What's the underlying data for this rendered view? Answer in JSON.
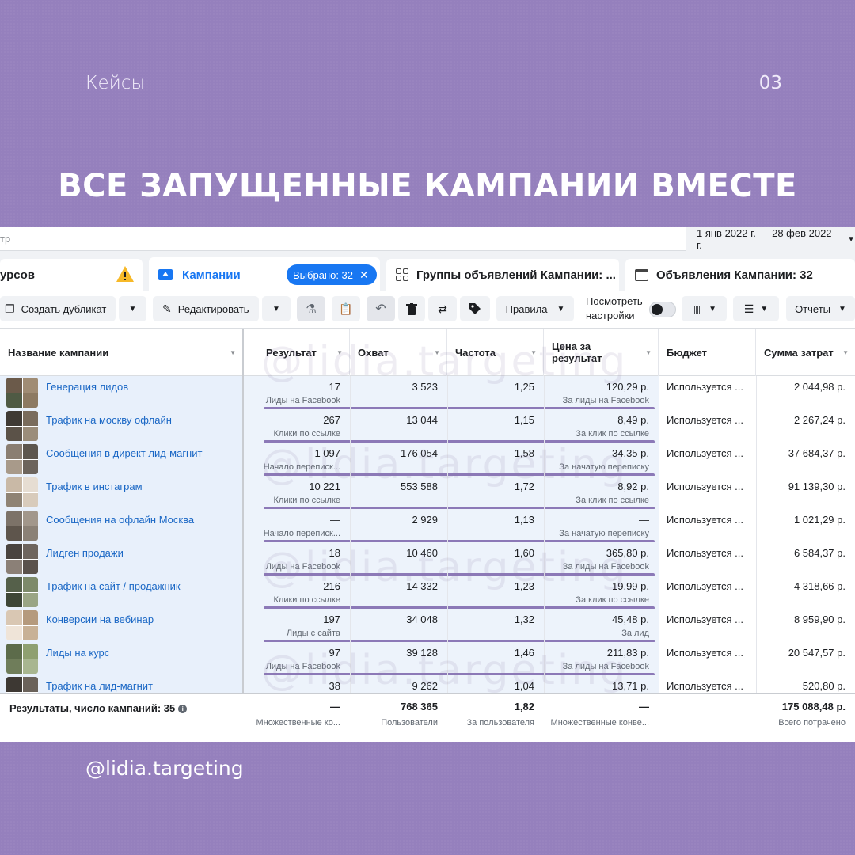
{
  "slide": {
    "section": "Кейсы",
    "page_number": "03",
    "headline": "ВСЕ ЗАПУЩЕННЫЕ КАМПАНИИ ВМЕСТЕ",
    "handle": "@lidia.targeting",
    "watermark": "@lidia.targeting",
    "background_color": "#9580bd"
  },
  "filter_bar": {
    "filter_text": "тр",
    "date_range": "1 янв 2022 г. — 28 фев 2022 г."
  },
  "tabs": [
    {
      "label": "урсов",
      "icon": "warning-icon"
    },
    {
      "label": "Кампании",
      "icon": "folder-icon",
      "selected_badge": "Выбрано: 32"
    },
    {
      "label": "Группы объявлений Кампании: ...",
      "icon": "grid-icon"
    },
    {
      "label": "Объявления Кампании: 32",
      "icon": "window-icon"
    }
  ],
  "toolbar": {
    "duplicate": "Создать дубликат",
    "edit": "Редактировать",
    "rules": "Правила",
    "view_settings": "Посмотреть настройки",
    "reports": "Отчеты"
  },
  "columns": {
    "name": "Название кампании",
    "results": "Результат",
    "reach": "Охват",
    "frequency": "Частота",
    "cost": "Цена за результат",
    "budget": "Бюджет",
    "spent": "Сумма затрат"
  },
  "rows": [
    {
      "name": "Генерация лидов",
      "result": "17",
      "result_type": "Лиды на Facebook",
      "reach": "3 523",
      "frequency": "1,25",
      "cost": "120,29 р.",
      "cost_type": "За лиды на Facebook",
      "budget": "Используется ...",
      "spent": "2 044,98 р."
    },
    {
      "name": "Трафик на москву офлайн",
      "result": "267",
      "result_type": "Клики по ссылке",
      "reach": "13 044",
      "frequency": "1,15",
      "cost": "8,49 р.",
      "cost_type": "За клик по ссылке",
      "budget": "Используется ...",
      "spent": "2 267,24 р."
    },
    {
      "name": "Сообщения в директ лид-магнит",
      "result": "1 097",
      "result_type": "Начало переписк...",
      "reach": "176 054",
      "frequency": "1,58",
      "cost": "34,35 р.",
      "cost_type": "За начатую переписку",
      "budget": "Используется ...",
      "spent": "37 684,37 р."
    },
    {
      "name": "Трафик в инстаграм",
      "result": "10 221",
      "result_type": "Клики по ссылке",
      "reach": "553 588",
      "frequency": "1,72",
      "cost": "8,92 р.",
      "cost_type": "За клик по ссылке",
      "budget": "Используется ...",
      "spent": "91 139,30 р."
    },
    {
      "name": "Сообщения на офлайн Москва",
      "result": "—",
      "result_type": "Начало переписк...",
      "reach": "2 929",
      "frequency": "1,13",
      "cost": "—",
      "cost_type": "За начатую переписку",
      "budget": "Используется ...",
      "spent": "1 021,29 р."
    },
    {
      "name": "Лидген продажи",
      "result": "18",
      "result_type": "Лиды на Facebook",
      "reach": "10 460",
      "frequency": "1,60",
      "cost": "365,80 р.",
      "cost_type": "За лиды на Facebook",
      "budget": "Используется ...",
      "spent": "6 584,37 р."
    },
    {
      "name": "Трафик на сайт / продажник",
      "result": "216",
      "result_type": "Клики по ссылке",
      "reach": "14 332",
      "frequency": "1,23",
      "cost": "19,99 р.",
      "cost_type": "За клик по ссылке",
      "budget": "Используется ...",
      "spent": "4 318,66 р."
    },
    {
      "name": "Конверсии на вебинар",
      "result": "197",
      "result_type": "Лиды с сайта",
      "reach": "34 048",
      "frequency": "1,32",
      "cost": "45,48 р.",
      "cost_type": "За лид",
      "budget": "Используется ...",
      "spent": "8 959,90 р."
    },
    {
      "name": "Лиды на курс",
      "result": "97",
      "result_type": "Лиды на Facebook",
      "reach": "39 128",
      "frequency": "1,46",
      "cost": "211,83 р.",
      "cost_type": "За лиды на Facebook",
      "budget": "Используется ...",
      "spent": "20 547,57 р."
    },
    {
      "name": "Трафик на лид-магнит",
      "result": "38",
      "result_type": "",
      "reach": "9 262",
      "frequency": "1,04",
      "cost": "13,71 р.",
      "cost_type": "",
      "budget": "Используется ...",
      "spent": "520,80 р."
    }
  ],
  "totals": {
    "label": "Результаты, число кампаний: 35",
    "result": "—",
    "result_sub": "Множественные ко...",
    "reach": "768 365",
    "reach_sub": "Пользователи",
    "frequency": "1,82",
    "frequency_sub": "За пользователя",
    "cost": "—",
    "cost_sub": "Множественные конве...",
    "spent": "175 088,48 р.",
    "spent_sub": "Всего потрачено"
  },
  "colors": {
    "link": "#1a67c5",
    "accent": "#1877f2",
    "highlight_line": "#8c79b7",
    "warning": "#f7b928"
  }
}
